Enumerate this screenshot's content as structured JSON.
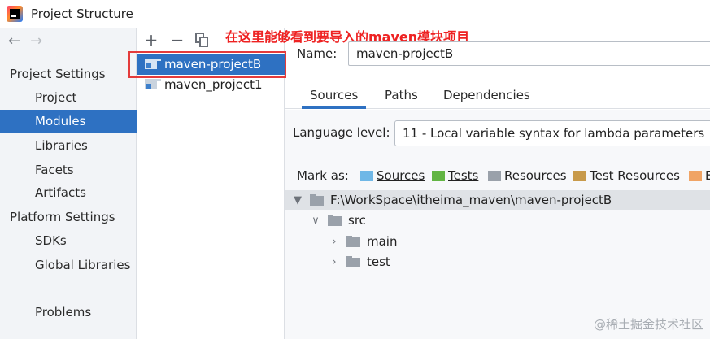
{
  "window": {
    "title": "Project Structure"
  },
  "annotation": {
    "text": "在这里能够看到要导入的maven模块项目"
  },
  "nav": {
    "back_icon": "←",
    "forward_icon": "→",
    "group_project": "Project Settings",
    "project": "Project",
    "modules": "Modules",
    "libraries": "Libraries",
    "facets": "Facets",
    "artifacts": "Artifacts",
    "group_platform": "Platform Settings",
    "sdks": "SDKs",
    "global_libraries": "Global Libraries",
    "problems": "Problems"
  },
  "module_toolbar": {
    "add": "+",
    "remove": "−"
  },
  "modules": [
    {
      "name": "maven-projectB",
      "selected": true
    },
    {
      "name": "maven_project1",
      "selected": false
    }
  ],
  "detail": {
    "name_label": "Name:",
    "name_value": "maven-projectB",
    "tabs": [
      "Sources",
      "Paths",
      "Dependencies"
    ],
    "active_tab": "Sources",
    "language_label": "Language level:",
    "language_value": "11 - Local variable syntax for lambda parameters",
    "mark_as_label": "Mark as:",
    "mark_as": [
      {
        "label": "Sources",
        "color": "#6fb7e6"
      },
      {
        "label": "Tests",
        "color": "#62b543"
      },
      {
        "label": "Resources",
        "color": "#9aa1aa"
      },
      {
        "label": "Test Resources",
        "color": "#c89a4a"
      },
      {
        "label": "E",
        "color": "#f0a465"
      }
    ],
    "tree": {
      "root": "F:\\WorkSpace\\itheima_maven\\maven-projectB",
      "src": "src",
      "main": "main",
      "test": "test"
    }
  },
  "watermark": "@稀土掘金技术社区",
  "colors": {
    "selection": "#2e71c2",
    "annotation": "#ee2222",
    "frame": "#e43b3b"
  }
}
